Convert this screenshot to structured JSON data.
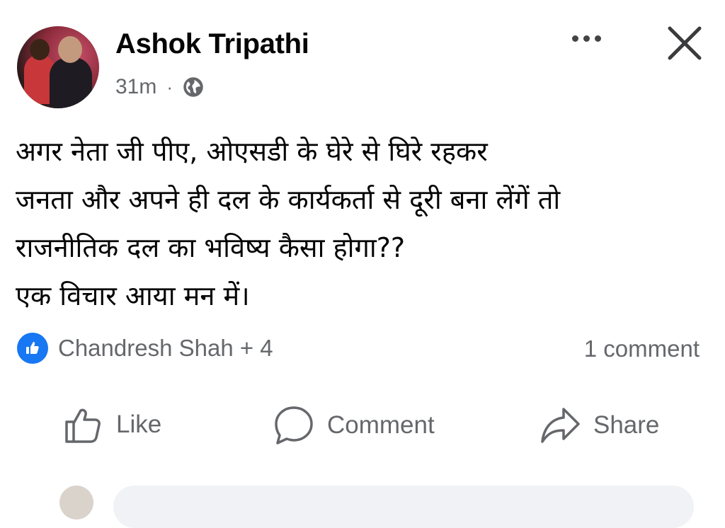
{
  "post": {
    "author": "Ashok Tripathi",
    "time": "31m",
    "separator": "·",
    "privacy_icon": "globe-icon",
    "text_lines": [
      "अगर नेता जी पीए, ओएसडी के घेरे से घिरे रहकर",
      "जनता और अपने ही दल के कार्यकर्ता से दूरी बना लेंगें तो",
      "राजनीतिक दल का भविष्य कैसा होगा??",
      "एक विचार आया मन में।"
    ]
  },
  "reactions": {
    "icon": "like-reaction-icon",
    "summary": "Chandresh Shah + 4",
    "comment_count": "1 comment"
  },
  "actions": {
    "like_label": "Like",
    "comment_label": "Comment",
    "share_label": "Share"
  },
  "colors": {
    "accent": "#1877f2",
    "secondary_text": "#65676b",
    "primary_text": "#050505"
  }
}
